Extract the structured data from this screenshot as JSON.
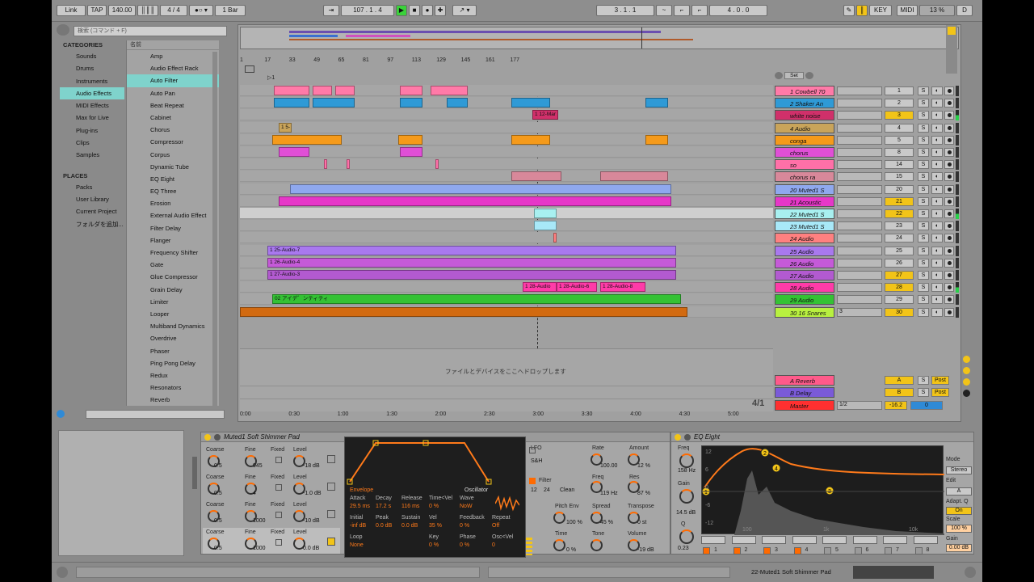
{
  "topbar": {
    "link": "Link",
    "tap": "TAP",
    "tempo": "140.00",
    "sig": "4 / 4",
    "quant": "1 Bar",
    "pos": "107 .  1 .  4",
    "loop_start": "3 .  1 .  1",
    "loop_len": "4 .  0 .  0",
    "key": "KEY",
    "midi": "MIDI",
    "cpu": "13 %",
    "d": "D"
  },
  "browser": {
    "search_placeholder": "検索 (コマンド + F)",
    "categories_header": "CATEGORIES",
    "categories": [
      "Sounds",
      "Drums",
      "Instruments",
      "Audio Effects",
      "MIDI Effects",
      "Max for Live",
      "Plug-ins",
      "Clips",
      "Samples"
    ],
    "places_header": "PLACES",
    "places": [
      "Packs",
      "User Library",
      "Current Project",
      "フォルダを追加..."
    ],
    "files_header": "名前",
    "files": [
      "Amp",
      "Audio Effect Rack",
      "Auto Filter",
      "Auto Pan",
      "Beat Repeat",
      "Cabinet",
      "Chorus",
      "Compressor",
      "Corpus",
      "Dynamic Tube",
      "EQ Eight",
      "EQ Three",
      "Erosion",
      "External Audio Effect",
      "Filter Delay",
      "Flanger",
      "Frequency Shifter",
      "Gate",
      "Glue Compressor",
      "Grain Delay",
      "Limiter",
      "Looper",
      "Multiband Dynamics",
      "Overdrive",
      "Phaser",
      "Ping Pong Delay",
      "Redux",
      "Resonators",
      "Reverb"
    ]
  },
  "arrangement": {
    "ruler": [
      "1",
      "17",
      "33",
      "49",
      "65",
      "81",
      "97",
      "113",
      "129",
      "145",
      "161",
      "177"
    ],
    "drop_hint": "ファイルとデバイスをここへドロップします",
    "time": [
      "0:00",
      "0:30",
      "1:00",
      "1:30",
      "2:00",
      "2:30",
      "3:00",
      "3:30",
      "4:00",
      "4:30",
      "5:00"
    ],
    "page": "4/1",
    "set_label": "Set"
  },
  "clip_labels": {
    "c1": "1 5-",
    "c2": "1 12-Mar",
    "c3": "1 25-Audio-7",
    "c4": "1 26-Audio-4",
    "c5": "1 27-Audio-3",
    "c6": "1 28-Audio",
    "c7": "1 28-Audio-6",
    "c8": "1 28-Audio-8",
    "c9": "02 アイデ゛ンティティ"
  },
  "tracks": [
    {
      "name": "1 Cowbell 70",
      "num": "1",
      "color": "#ff7aa8"
    },
    {
      "name": "2 Shaker An",
      "num": "2",
      "color": "#2f9ad6"
    },
    {
      "name": "white noise",
      "num": "3",
      "color": "#d0306a"
    },
    {
      "name": "4 Audio",
      "num": "4",
      "color": "#c9a45a"
    },
    {
      "name": "conga",
      "num": "5",
      "color": "#f59a1a"
    },
    {
      "name": "chorus",
      "num": "8",
      "color": "#e04fd6"
    },
    {
      "name": "so",
      "num": "14",
      "color": "#ff70a8"
    },
    {
      "name": "chorus ra",
      "num": "15",
      "color": "#d8889a"
    },
    {
      "name": "20 Muted1 S",
      "num": "20",
      "color": "#8fa8ee"
    },
    {
      "name": "21 Acoustic",
      "num": "21",
      "color": "#e637c8"
    },
    {
      "name": "22 Muted1 S",
      "num": "22",
      "color": "#a8f0f0"
    },
    {
      "name": "23 Muted1 S",
      "num": "23",
      "color": "#a8e8f8"
    },
    {
      "name": "24 Audio",
      "num": "24",
      "color": "#ff8080"
    },
    {
      "name": "25 Audio",
      "num": "25",
      "color": "#a978ee"
    },
    {
      "name": "26 Audio",
      "num": "26",
      "color": "#c55ad8"
    },
    {
      "name": "27 Audio",
      "num": "27",
      "color": "#b25ad0"
    },
    {
      "name": "28 Audio",
      "num": "28",
      "color": "#ff3ba8"
    },
    {
      "name": "29 Audio",
      "num": "29",
      "color": "#34c234"
    },
    {
      "name": "30 16 Snares",
      "num": "30",
      "color": "#b8f040"
    }
  ],
  "returns": [
    {
      "name": "A Reverb",
      "num": "A",
      "post": "Post",
      "color": "#ff5a8a"
    },
    {
      "name": "B Delay",
      "num": "B",
      "post": "Post",
      "color": "#7a5ad8"
    },
    {
      "name": "Master",
      "num": "0",
      "color": "#ff3030",
      "cue": "1/2",
      "vol": "-16.2"
    }
  ],
  "snares_slot": "3",
  "sampler": {
    "title": "Muted1 Soft Shimmer Pad",
    "rows": [
      {
        "coarse": "Coarse",
        "fine": "Fine",
        "fixed": "Fixed",
        "level": "Level",
        "cv": "0.5",
        "fv": "945",
        "lv": "-18 dB"
      },
      {
        "coarse": "Coarse",
        "fine": "Fine",
        "fixed": "Fixed",
        "level": "Level",
        "cv": "0.5",
        "fv": "4",
        "lv": "-1.0 dB"
      },
      {
        "coarse": "Coarse",
        "fine": "Fine",
        "fixed": "Fixed",
        "level": "Level",
        "cv": "0.5",
        "fv": "1000",
        "lv": "-10 dB"
      },
      {
        "coarse": "Coarse",
        "fine": "Fine",
        "fixed": "Fixed",
        "level": "Level",
        "cv": "0.5",
        "fv": "1000",
        "lv": "0.0 dB"
      }
    ]
  },
  "env": {
    "envelope": "Envelope",
    "oscillator": "Oscillator",
    "attack": "Attack",
    "decay": "Decay",
    "release": "Release",
    "timevel": "Time<Vel",
    "wave": "Wave",
    "attack_v": "29.5 ms",
    "decay_v": "17.2 s",
    "release_v": "116 ms",
    "timevel_v": "0 %",
    "wave_v": "NoW",
    "initial": "Initial",
    "peak": "Peak",
    "sustain": "Sustain",
    "vel": "Vel",
    "feedback": "Feedback",
    "repeat": "Repeat",
    "initial_v": "-inf dB",
    "peak_v": "0.0 dB",
    "sustain_v": "0.0 dB",
    "vel_v": "35 %",
    "feedback_v": "0 %",
    "repeat_v": "Off",
    "loop": "Loop",
    "key": "Key",
    "phase": "Phase",
    "oscvel": "Osc<Vel",
    "loop_v": "None",
    "key_v": "0 %",
    "phase_v": "0 %",
    "oscvel_v": "0"
  },
  "lfo": {
    "lfo": "LFO",
    "rate": "Rate",
    "amount": "Amount",
    "mode": "S&H",
    "rate_v": "100.00",
    "amount_v": "12 %",
    "filter": "Filter",
    "freq": "Freq",
    "res": "Res",
    "f12": "12",
    "f24": "24",
    "clean": "Clean",
    "freq_v": "119 Hz",
    "res_v": "87 %",
    "pitchenv": "Pitch Env",
    "spread": "Spread",
    "transpose": "Transpose",
    "pitchenv_v": "100 %",
    "spread_v": "45 %",
    "transpose_v": "0 st",
    "time": "Time",
    "tone": "Tone",
    "volume": "Volume",
    "time_v": "0 %",
    "tone_v": "",
    "volume_v": "-19 dB"
  },
  "eq": {
    "title": "EQ Eight",
    "freq": "Freq",
    "freq_v": "158 Hz",
    "gain": "Gain",
    "gain_v": "14.5 dB",
    "q": "Q",
    "q_v": "0.23",
    "mode": "Mode",
    "mode_v": "Stereo",
    "edit": "Edit",
    "edit_v": "A",
    "adapt": "Adapt. Q",
    "adapt_v": "On",
    "scale": "Scale",
    "scale_v": "100 %",
    "outgain": "Gain",
    "outgain_v": "0.00 dB",
    "ylabels": [
      "12",
      "6",
      "0",
      "-6",
      "-12"
    ],
    "xlabels": [
      "100",
      "1k",
      "10k"
    ],
    "bands": [
      "1",
      "2",
      "3",
      "4",
      "5",
      "6",
      "7",
      "8"
    ]
  },
  "status": {
    "track": "22-Muted1 Soft Shimmer Pad"
  }
}
